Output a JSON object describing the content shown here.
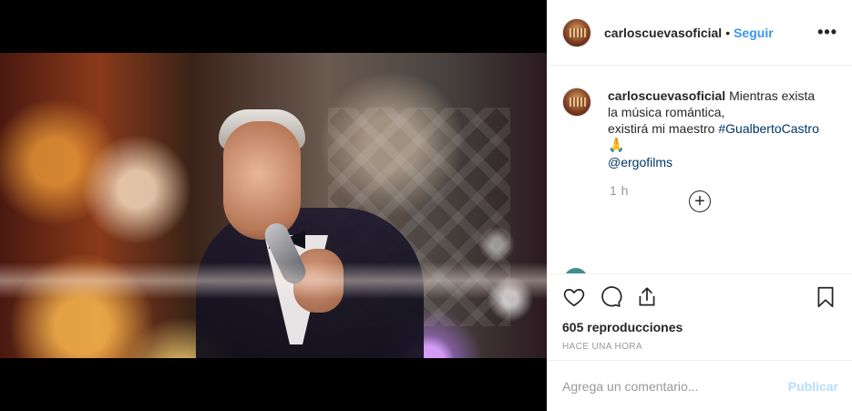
{
  "post": {
    "username": "carloscuevasoficial",
    "follow_label": "Seguir",
    "dot": "•",
    "more_icon": "•••",
    "caption_main": " Mientras exista la música romántica,",
    "caption_line2": "existirá mi maestro ",
    "hashtag": "#GualbertoCastro",
    "emoji": "🙏",
    "mention": "@ergofilms",
    "relative_time": "1 h",
    "load_more_icon": "+",
    "views": "605 reproducciones",
    "posted_ago": "HACE UNA HORA",
    "comment_placeholder": "Agrega un comentario...",
    "publish_label": "Publicar"
  },
  "colors": {
    "link_blue": "#3897f0",
    "hashtag_blue": "#003569",
    "muted": "#999999",
    "publish_disabled": "#b2dffc"
  },
  "icons": [
    "heart-icon",
    "comment-icon",
    "share-icon",
    "bookmark-icon",
    "plus-circle-icon",
    "more-icon"
  ]
}
